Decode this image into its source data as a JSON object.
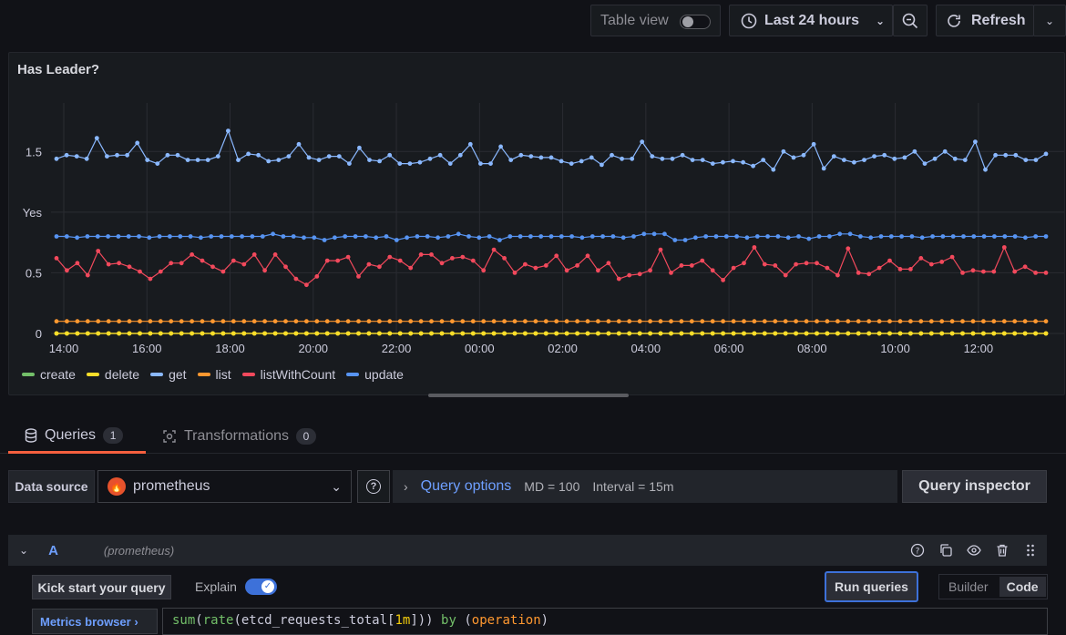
{
  "toolbar": {
    "table_view_label": "Table view",
    "time_range_label": "Last 24 hours",
    "refresh_label": "Refresh"
  },
  "panel": {
    "title": "Has Leader?"
  },
  "chart_data": {
    "type": "line",
    "y_ticks": [
      {
        "value": 0,
        "label": "0"
      },
      {
        "value": 0.5,
        "label": "0.5"
      },
      {
        "value": 1,
        "label": "Yes"
      },
      {
        "value": 1.5,
        "label": "1.5"
      }
    ],
    "x_ticks": [
      "14:00",
      "16:00",
      "18:00",
      "20:00",
      "22:00",
      "00:00",
      "02:00",
      "04:00",
      "06:00",
      "08:00",
      "10:00",
      "12:00"
    ],
    "ylim": [
      0,
      1.9
    ],
    "grid": true,
    "legend": "bottom-left",
    "series": [
      {
        "name": "create",
        "color": "#73bf69",
        "values": [
          0
        ]
      },
      {
        "name": "delete",
        "color": "#fade2a",
        "values": [
          0
        ]
      },
      {
        "name": "get",
        "color": "#8ab8ff",
        "values": [
          1.44,
          1.47,
          1.46,
          1.44,
          1.61,
          1.46,
          1.47,
          1.47,
          1.57,
          1.43,
          1.4,
          1.47,
          1.47,
          1.43,
          1.43,
          1.43,
          1.46,
          1.67,
          1.43,
          1.48,
          1.47,
          1.42,
          1.43,
          1.46,
          1.56,
          1.45,
          1.43,
          1.46,
          1.46,
          1.4,
          1.53,
          1.43,
          1.42,
          1.47,
          1.4,
          1.4,
          1.41,
          1.44,
          1.47,
          1.4,
          1.47,
          1.56,
          1.4,
          1.4,
          1.54,
          1.43,
          1.47,
          1.46,
          1.45,
          1.45,
          1.42,
          1.4,
          1.42,
          1.45,
          1.39,
          1.47,
          1.44,
          1.44,
          1.58,
          1.46,
          1.44,
          1.44,
          1.47,
          1.43,
          1.43,
          1.4,
          1.41,
          1.42,
          1.41,
          1.38,
          1.43,
          1.35,
          1.5,
          1.45,
          1.47,
          1.56,
          1.36,
          1.46,
          1.43,
          1.41,
          1.43,
          1.46,
          1.47,
          1.44,
          1.45,
          1.5,
          1.4,
          1.44,
          1.5,
          1.44,
          1.43,
          1.58,
          1.35,
          1.47,
          1.47,
          1.47,
          1.43,
          1.43,
          1.48
        ]
      },
      {
        "name": "list",
        "color": "#ff9830",
        "values": [
          0.1
        ]
      },
      {
        "name": "listWithCount",
        "color": "#f2495c",
        "values": [
          0.62,
          0.52,
          0.58,
          0.48,
          0.68,
          0.57,
          0.58,
          0.55,
          0.51,
          0.45,
          0.51,
          0.58,
          0.58,
          0.65,
          0.6,
          0.55,
          0.51,
          0.6,
          0.57,
          0.65,
          0.52,
          0.65,
          0.55,
          0.45,
          0.4,
          0.47,
          0.6,
          0.6,
          0.63,
          0.47,
          0.57,
          0.55,
          0.63,
          0.6,
          0.54,
          0.65,
          0.65,
          0.58,
          0.62,
          0.63,
          0.6,
          0.52,
          0.69,
          0.62,
          0.5,
          0.57,
          0.54,
          0.56,
          0.64,
          0.52,
          0.56,
          0.64,
          0.52,
          0.58,
          0.45,
          0.48,
          0.49,
          0.52,
          0.69,
          0.5,
          0.56,
          0.56,
          0.6,
          0.52,
          0.44,
          0.54,
          0.58,
          0.71,
          0.57,
          0.56,
          0.48,
          0.57,
          0.58,
          0.58,
          0.54,
          0.48,
          0.7,
          0.5,
          0.49,
          0.54,
          0.6,
          0.53,
          0.53,
          0.62,
          0.57,
          0.59,
          0.63,
          0.5,
          0.52,
          0.51,
          0.51,
          0.71,
          0.51,
          0.55,
          0.5,
          0.5
        ]
      },
      {
        "name": "update",
        "color": "#5794f2",
        "values": [
          0.8,
          0.8,
          0.79,
          0.8,
          0.8,
          0.8,
          0.8,
          0.8,
          0.8,
          0.79,
          0.8,
          0.8,
          0.8,
          0.8,
          0.79,
          0.8,
          0.8,
          0.8,
          0.8,
          0.8,
          0.8,
          0.82,
          0.8,
          0.8,
          0.79,
          0.79,
          0.77,
          0.79,
          0.8,
          0.8,
          0.8,
          0.79,
          0.8,
          0.77,
          0.79,
          0.8,
          0.8,
          0.79,
          0.8,
          0.82,
          0.8,
          0.79,
          0.8,
          0.77,
          0.8,
          0.8,
          0.8,
          0.8,
          0.8,
          0.8,
          0.8,
          0.79,
          0.8,
          0.8,
          0.8,
          0.79,
          0.8,
          0.82,
          0.82,
          0.82,
          0.77,
          0.77,
          0.79,
          0.8,
          0.8,
          0.8,
          0.8,
          0.79,
          0.8,
          0.8,
          0.8,
          0.79,
          0.8,
          0.78,
          0.8,
          0.8,
          0.82,
          0.82,
          0.8,
          0.79,
          0.8,
          0.8,
          0.8,
          0.8,
          0.79,
          0.8,
          0.8,
          0.8,
          0.8,
          0.8,
          0.8,
          0.8,
          0.8,
          0.8,
          0.79,
          0.8,
          0.8
        ]
      }
    ]
  },
  "tabs": {
    "queries_label": "Queries",
    "queries_count": "1",
    "transformations_label": "Transformations",
    "transformations_count": "0"
  },
  "datasource": {
    "label": "Data source",
    "value": "prometheus"
  },
  "query_options": {
    "title": "Query options",
    "md": "MD = 100",
    "interval": "Interval = 15m",
    "inspector_label": "Query inspector"
  },
  "query": {
    "letter": "A",
    "datasource": "(prometheus)",
    "kick_start_label": "Kick start your query",
    "explain_label": "Explain",
    "run_label": "Run queries",
    "builder_label": "Builder",
    "code_label": "Code",
    "metrics_browser_label": "Metrics browser ›",
    "expression": "sum(rate(etcd_requests_total[1m])) by (operation)"
  }
}
